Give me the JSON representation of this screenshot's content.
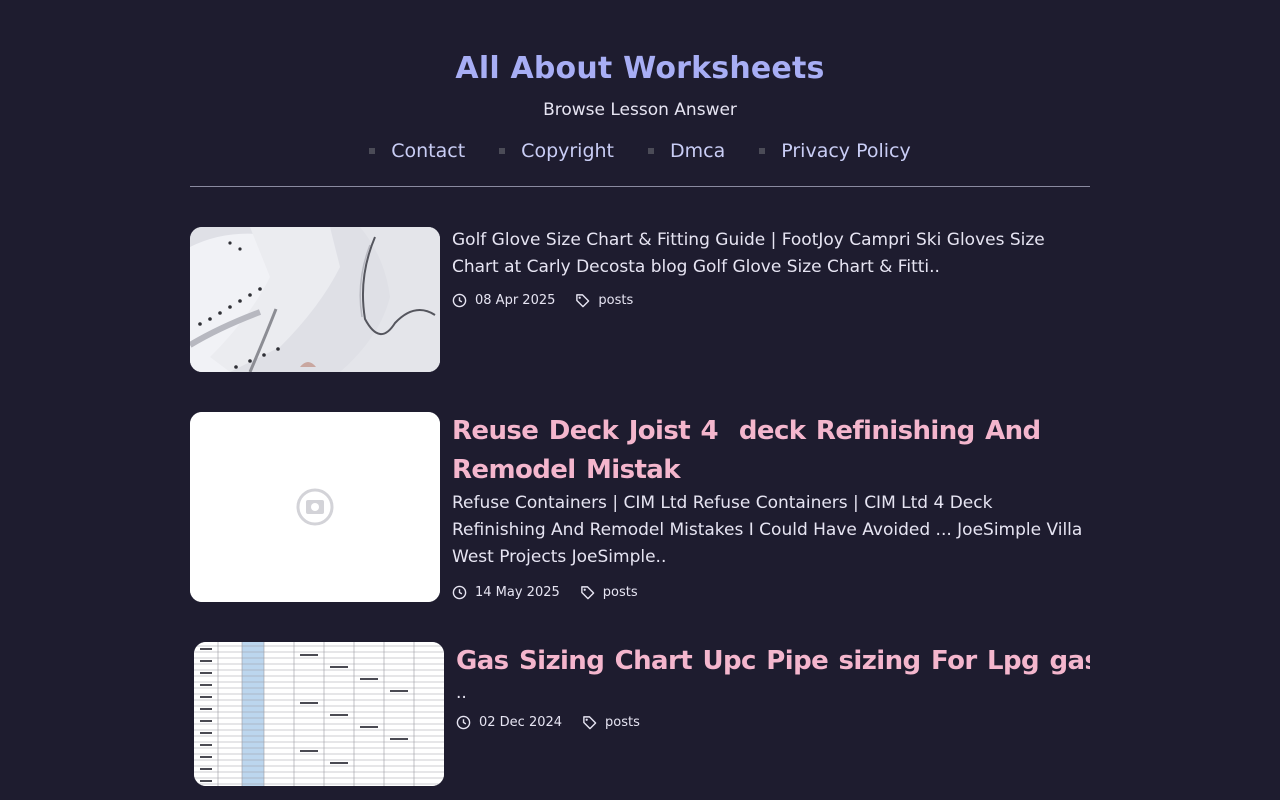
{
  "site": {
    "title": "All About Worksheets",
    "description": "Browse Lesson Answer"
  },
  "nav": {
    "items": [
      {
        "label": "Contact"
      },
      {
        "label": "Copyright"
      },
      {
        "label": "Dmca"
      },
      {
        "label": "Privacy Policy"
      }
    ]
  },
  "posts": [
    {
      "title": "",
      "excerpt": "Golf Glove Size Chart & Fitting Guide | FootJoy Campri Ski Gloves Size Chart at Carly Decosta blog Golf Glove Size Chart & Fitti..",
      "date": "08 Apr 2025",
      "tag": "posts",
      "thumb_icon": "golf-glove-photo"
    },
    {
      "title": "Reuse Deck Joist 4  deck Refinishing And Remodel Mistak",
      "excerpt": "Refuse Containers | CIM Ltd Refuse Containers | CIM Ltd 4 Deck Refinishing And Remodel Mistakes I Could Have Avoided ... JoeSimple Villa West Projects JoeSimple..",
      "date": "14 May 2025",
      "tag": "posts",
      "thumb_icon": "camera-placeholder-icon"
    },
    {
      "title": "Gas Sizing Chart Upc Pipe  sizing For Lpg  gas Nat",
      "excerpt": "..",
      "date": "02 Dec 2024",
      "tag": "posts",
      "thumb_icon": "spreadsheet-table-photo"
    }
  ],
  "colors": {
    "background": "#1e1c2f",
    "site_title": "#a8aef5",
    "post_title": "#f4b6cd",
    "text": "#e6e4f2"
  }
}
